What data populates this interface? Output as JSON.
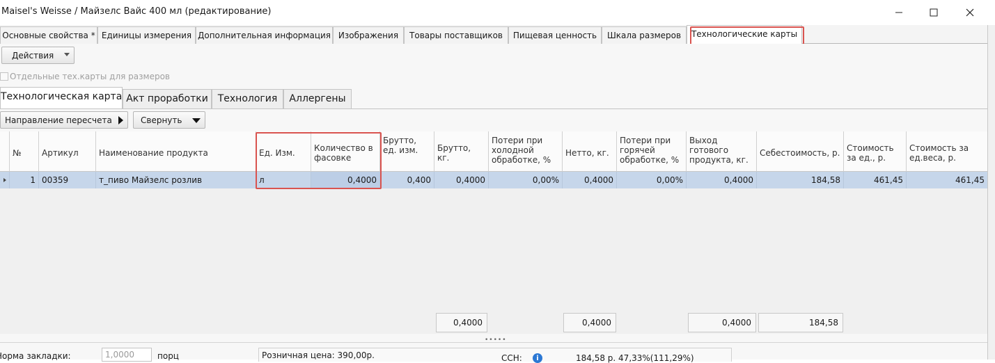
{
  "window": {
    "title": "Maisel's Weisse / Майзелс Вайс 400 мл (редактирование)"
  },
  "top_tabs": [
    {
      "label": "Основные свойства *"
    },
    {
      "label": "Единицы измерения"
    },
    {
      "label": "Дополнительная информация"
    },
    {
      "label": "Изображения"
    },
    {
      "label": "Товары поставщиков"
    },
    {
      "label": "Пищевая ценность"
    },
    {
      "label": "Шкала размеров"
    },
    {
      "label": "Технологические карты"
    }
  ],
  "toolbar": {
    "actions_label": "Действия"
  },
  "separate_cards": {
    "label": "Отдельные тех.карты для размеров"
  },
  "sub_tabs": [
    {
      "label": "Технологическая карта"
    },
    {
      "label": "Акт проработки"
    },
    {
      "label": "Технология"
    },
    {
      "label": "Аллергены"
    }
  ],
  "grid_toolbar": {
    "recalc_label": "Направление пересчета",
    "collapse_label": "Свернуть"
  },
  "grid": {
    "columns": [
      "№",
      "Артикул",
      "Наименование продукта",
      "Ед. Изм.",
      "Количество в фасовке",
      "Брутто, ед. изм.",
      "Брутто, кг.",
      "Потери при холодной обработке, %",
      "Нетто, кг.",
      "Потери при горячей обработке, %",
      "Выход готового продукта, кг.",
      "Себестоимость, р.",
      "Стоимость за ед., р.",
      "Стоимость за ед.веса, р."
    ],
    "rows": [
      [
        "1",
        "00359",
        "т_пиво Майзелс розлив",
        "л",
        "0,4000",
        "0,400",
        "0,4000",
        "0,00%",
        "0,4000",
        "0,00%",
        "0,4000",
        "184,58",
        "461,45",
        "461,45"
      ]
    ],
    "totals": {
      "brutto_kg": "0,4000",
      "netto_kg": "0,4000",
      "output_kg": "0,4000",
      "cost": "184,58"
    }
  },
  "bottom": {
    "norm_label": "Норма закладки:",
    "norm_value": "1,0000",
    "norm_unit": "порц",
    "retail_price": "Розничная цена:  390,00р.",
    "ssn_label": "ССН:",
    "ssn_value": "184,58 р.  47,33%(111,29%)"
  },
  "colors": {
    "highlight": "#d9534f",
    "selected_row": "#c6d6ea"
  }
}
